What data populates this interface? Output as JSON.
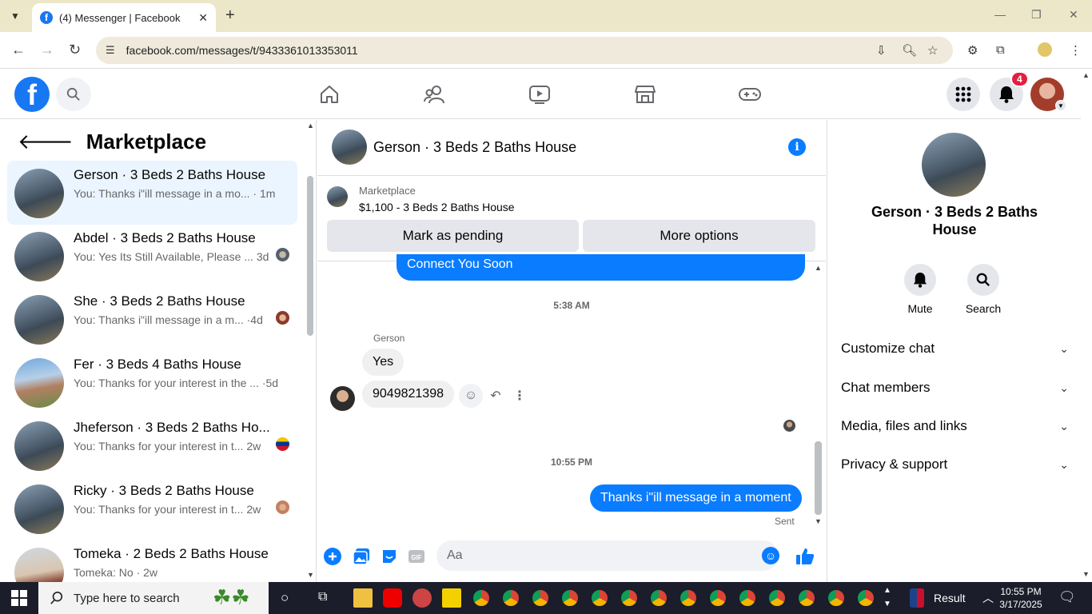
{
  "browser": {
    "tab_title": "(4) Messenger | Facebook",
    "url": "facebook.com/messages/t/9433361013353011"
  },
  "fb": {
    "notification_count": "4"
  },
  "left": {
    "title": "Marketplace",
    "conversations": [
      {
        "name": "Gerson · 3 Beds 2 Baths House",
        "preview": "You: Thanks i\"ill message in a mo...",
        "time": "· 1m"
      },
      {
        "name": "Abdel · 3 Beds 2 Baths House",
        "preview": "You: Yes Its Still Available, Please ...",
        "time": "3d"
      },
      {
        "name": "She · 3 Beds 2 Baths House",
        "preview": "You: Thanks i\"ill message in a m...",
        "time": "·4d"
      },
      {
        "name": "Fer · 3 Beds 4 Baths House",
        "preview": "You: Thanks for your interest in the ...",
        "time": "·5d"
      },
      {
        "name": "Jheferson · 3 Beds 2 Baths Ho...",
        "preview": "You: Thanks for your interest in t...",
        "time": "2w"
      },
      {
        "name": "Ricky · 3 Beds 2 Baths House",
        "preview": "You: Thanks for your interest in t...",
        "time": "2w"
      },
      {
        "name": "Tomeka · 2 Beds 2 Baths House",
        "preview": "Tomeka: No · 2w",
        "time": ""
      }
    ]
  },
  "chat": {
    "title": "Gerson · 3 Beds 2 Baths House",
    "listing_category": "Marketplace",
    "listing_title": "$1,100 - 3 Beds 2 Baths House",
    "mark_pending_label": "Mark as pending",
    "more_options_label": "More options",
    "prev_message": "Connect You Soon",
    "time1": "5:38 AM",
    "sender_name": "Gerson",
    "msg_yes": "Yes",
    "msg_number": "9049821398",
    "time2": "10:55 PM",
    "msg_out": "Thanks i\"ill message in a moment",
    "sent_label": "Sent",
    "composer_placeholder": "Aa"
  },
  "right": {
    "name": "Gerson · 3 Beds 2 Baths House",
    "mute_label": "Mute",
    "search_label": "Search",
    "sections": [
      "Customize chat",
      "Chat members",
      "Media, files and links",
      "Privacy & support"
    ]
  },
  "taskbar": {
    "search_placeholder": "Type here to search",
    "weather_label": "Result",
    "time": "10:55 PM",
    "date": "3/17/2025"
  },
  "colors": {
    "fb_blue": "#1877f2",
    "messenger_blue": "#0a7cff",
    "badge_red": "#e41e3f"
  }
}
